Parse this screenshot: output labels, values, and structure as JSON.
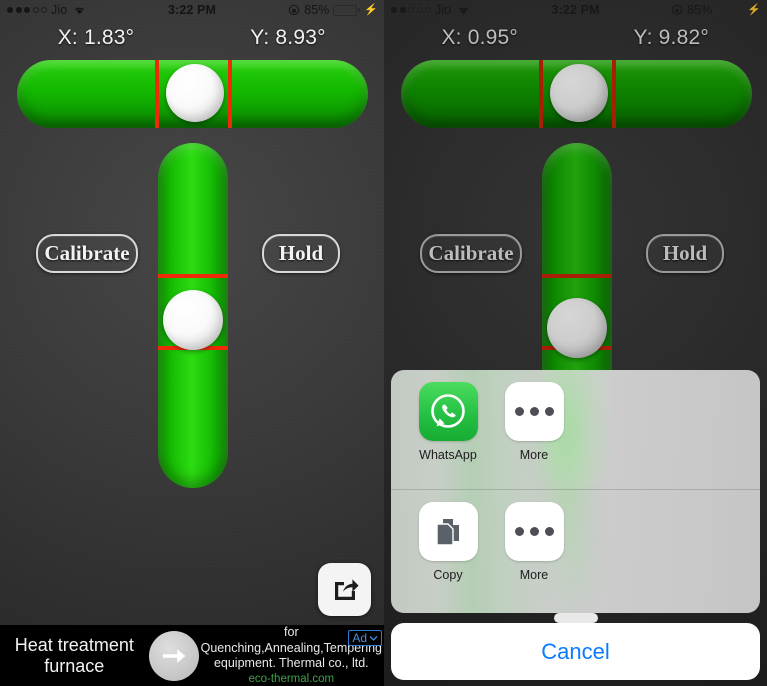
{
  "left": {
    "statusbar": {
      "signal_dots": [
        true,
        true,
        true,
        false,
        false
      ],
      "carrier": "Jio",
      "wifi_icon": "wifi-icon",
      "time": "3:22 PM",
      "rotation_lock_icon": "rotation-lock-icon",
      "battery_percent": "85%",
      "battery_level": 85,
      "charging_icon": "lightning-bolt-icon"
    },
    "readouts": {
      "x": "X: 1.83°",
      "y": "Y: 8.93°"
    },
    "buttons": {
      "calibrate": "Calibrate",
      "hold": "Hold"
    },
    "share_button_icon": "share-box-arrow-icon"
  },
  "right": {
    "statusbar": {
      "signal_dots": [
        true,
        true,
        false,
        false,
        false
      ],
      "carrier": "Jio",
      "wifi_icon": "wifi-icon",
      "time": "3:22 PM",
      "rotation_lock_icon": "rotation-lock-icon",
      "battery_percent": "85%",
      "battery_level": 85,
      "charging_icon": "lightning-bolt-icon"
    },
    "readouts": {
      "x": "X: 0.95°",
      "y": "Y: 9.82°"
    },
    "buttons": {
      "calibrate": "Calibrate",
      "hold": "Hold"
    }
  },
  "share_sheet": {
    "row1": [
      {
        "label": "WhatsApp",
        "icon": "whatsapp-icon"
      },
      {
        "label": "More",
        "icon": "more-ellipsis-icon"
      }
    ],
    "row2": [
      {
        "label": "Copy",
        "icon": "copy-documents-icon"
      },
      {
        "label": "More",
        "icon": "more-ellipsis-icon"
      }
    ],
    "cancel": "Cancel"
  },
  "ad": {
    "headline_line1": "Heat treatment",
    "headline_line2": "furnace",
    "arrow_icon": "arrow-right-icon",
    "body_line1": "for Quenching,Annealing,Tempering",
    "body_line2": "equipment. Thermal co., ltd.",
    "url": "eco-thermal.com",
    "badge": "Ad",
    "badge_chevron_icon": "chevron-down-icon"
  },
  "colors": {
    "tube_green": "#12b800",
    "marker_red": "#ef2a09",
    "bubble_white": "#ffffff",
    "cancel_blue": "#0a7bff",
    "ad_url_green": "#3ea34a",
    "background_dark": "#3b3b3b"
  }
}
